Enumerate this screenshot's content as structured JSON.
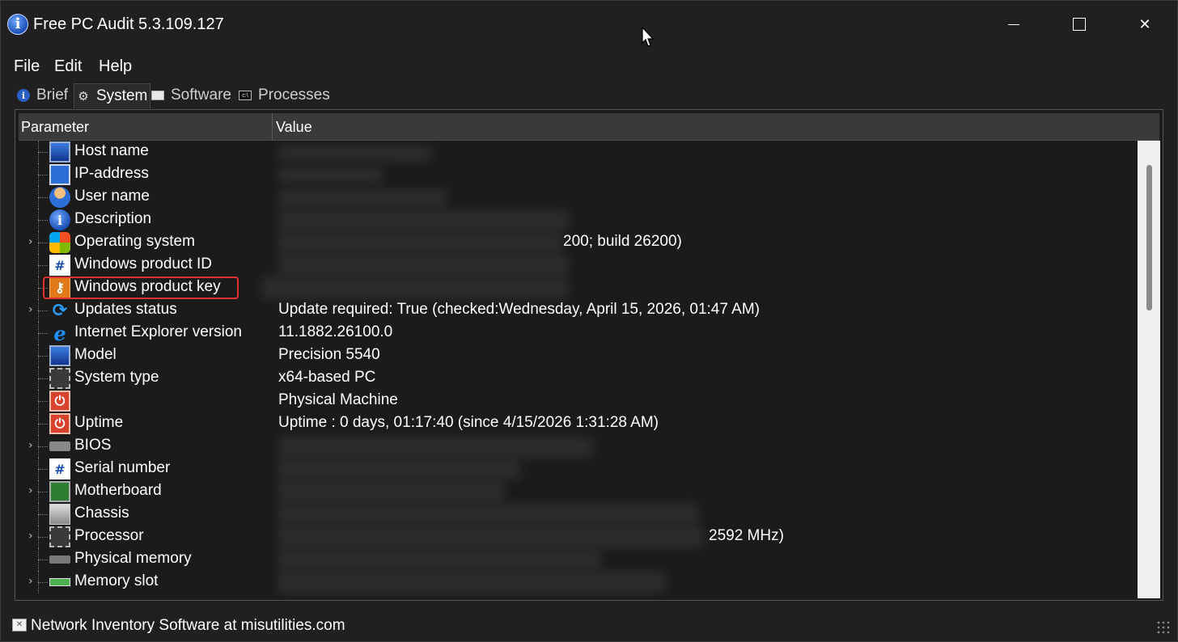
{
  "window": {
    "title": "Free PC Audit 5.3.109.127",
    "app_icon": "info-icon",
    "controls": {
      "minimize": "minimize-icon",
      "maximize": "maximize-icon",
      "close_glyph": "✕"
    }
  },
  "menu": {
    "file": "File",
    "edit": "Edit",
    "help": "Help"
  },
  "tabs": [
    {
      "label": "Brief",
      "icon": "info-icon"
    },
    {
      "label": "System",
      "icon": "gear-icon",
      "active": true
    },
    {
      "label": "Software",
      "icon": "window-icon"
    },
    {
      "label": "Processes",
      "icon": "console-icon"
    }
  ],
  "table": {
    "columns": {
      "param": "Parameter",
      "value": "Value"
    },
    "rows": [
      {
        "param": "Host name",
        "value": "",
        "icon": "monitor-icon",
        "expandable": false
      },
      {
        "param": "IP-address",
        "value": "",
        "icon": "network-icon",
        "expandable": false
      },
      {
        "param": "User name",
        "value": "",
        "icon": "user-icon",
        "expandable": false
      },
      {
        "param": "Description",
        "value": "",
        "icon": "info-icon",
        "expandable": false
      },
      {
        "param": "Operating system",
        "value": "200; build 26200)",
        "icon": "windows-logo-icon",
        "expandable": true
      },
      {
        "param": "Windows product ID",
        "value": "",
        "icon": "hash-icon",
        "expandable": false
      },
      {
        "param": "Windows product key",
        "value": "",
        "icon": "key-icon",
        "expandable": false,
        "highlighted": true
      },
      {
        "param": "Updates status",
        "value": "Update required: True (checked:Wednesday, April 15, 2026, 01:47 AM)",
        "icon": "refresh-icon",
        "expandable": true
      },
      {
        "param": "Internet Explorer version",
        "value": "11.1882.26100.0",
        "icon": "internet-explorer-icon",
        "expandable": false
      },
      {
        "param": "Model",
        "value": "Precision 5540",
        "icon": "monitor-icon",
        "expandable": false
      },
      {
        "param": "System type",
        "value": "x64-based PC",
        "icon": "chip-icon",
        "expandable": false
      },
      {
        "param": "",
        "value": "Physical Machine",
        "icon": "power-icon",
        "expandable": false
      },
      {
        "param": "Uptime",
        "value": "Uptime : 0 days, 01:17:40 (since 4/15/2026 1:31:28 AM)",
        "icon": "power-icon",
        "expandable": false
      },
      {
        "param": "BIOS",
        "value": "",
        "icon": "bios-chip-icon",
        "expandable": true
      },
      {
        "param": "Serial number",
        "value": "",
        "icon": "hash-icon",
        "expandable": false
      },
      {
        "param": "Motherboard",
        "value": "",
        "icon": "motherboard-icon",
        "expandable": true
      },
      {
        "param": "Chassis",
        "value": "",
        "icon": "chassis-icon",
        "expandable": false
      },
      {
        "param": "Processor",
        "value": "2592 MHz)",
        "icon": "chip-icon",
        "expandable": true
      },
      {
        "param": "Physical memory",
        "value": "",
        "icon": "memory-icon",
        "expandable": false
      },
      {
        "param": "Memory slot",
        "value": "",
        "icon": "memory-slot-icon",
        "expandable": true
      }
    ]
  },
  "status": {
    "text": "Network Inventory Software at misutilities.com",
    "icon": "link-icon"
  }
}
